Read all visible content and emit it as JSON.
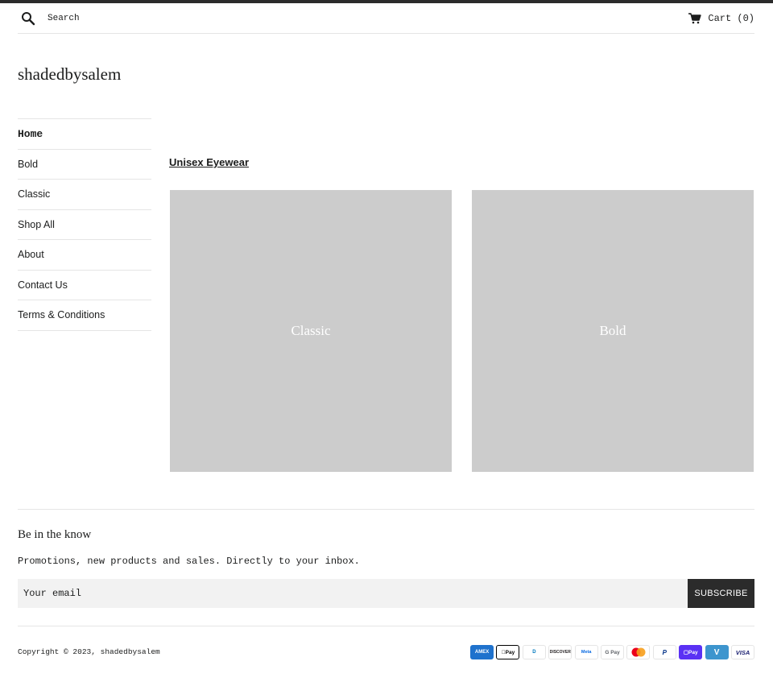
{
  "header": {
    "search_placeholder": "Search",
    "cart_label": "Cart (0)",
    "search_icon": "search-icon",
    "cart_icon": "cart-icon"
  },
  "site": {
    "logo": "shadedbysalem"
  },
  "nav": {
    "items": [
      {
        "label": "Home",
        "active": true
      },
      {
        "label": "Bold"
      },
      {
        "label": "Classic"
      },
      {
        "label": "Shop All"
      },
      {
        "label": "About"
      },
      {
        "label": "Contact Us"
      },
      {
        "label": "Terms & Conditions"
      }
    ]
  },
  "main": {
    "section_title": "Unisex Eyewear",
    "collections": [
      {
        "label": "Classic"
      },
      {
        "label": "Bold"
      }
    ]
  },
  "newsletter": {
    "heading": "Be in the know",
    "text": "Promotions, new products and sales. Directly to your inbox.",
    "email_placeholder": "Your email",
    "subscribe_label": "SUBSCRIBE"
  },
  "footer": {
    "copyright": "Copyright © 2023, shadedbysalem",
    "payment_methods": [
      {
        "name": "american-express-icon",
        "text": "AMEX"
      },
      {
        "name": "apple-pay-icon",
        "text": "Pay"
      },
      {
        "name": "diners-club-icon",
        "text": "D"
      },
      {
        "name": "discover-icon",
        "text": "DISCOVER"
      },
      {
        "name": "meta-pay-icon",
        "text": "Meta"
      },
      {
        "name": "google-pay-icon",
        "text": "G Pay"
      },
      {
        "name": "mastercard-icon",
        "text": ""
      },
      {
        "name": "paypal-icon",
        "text": "P"
      },
      {
        "name": "shop-pay-icon",
        "text": "Pay"
      },
      {
        "name": "venmo-icon",
        "text": "V"
      },
      {
        "name": "visa-icon",
        "text": "VISA"
      }
    ]
  },
  "colors": {
    "accent_dark": "#2b2b2b",
    "card_placeholder": "#cccccc",
    "input_background": "#f2f2f2",
    "divider": "#e5e5e5"
  }
}
